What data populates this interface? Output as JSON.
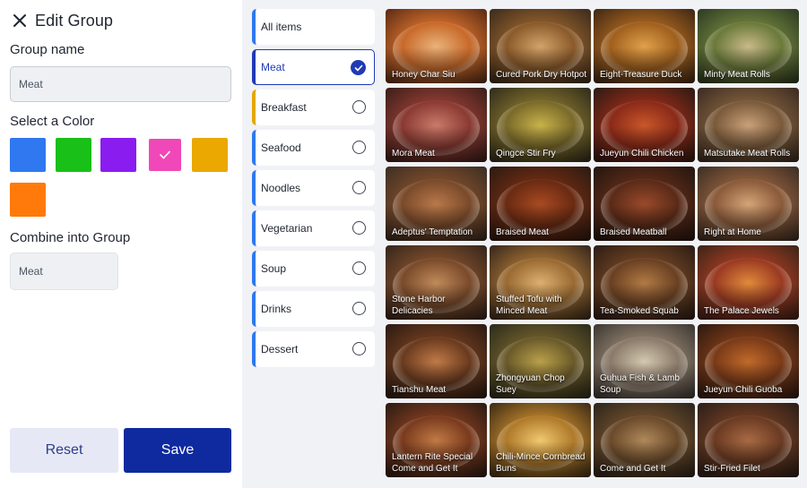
{
  "panel": {
    "title": "Edit Group",
    "group_name_label": "Group name",
    "group_name_value": "Meat",
    "color_label": "Select a Color",
    "colors": [
      "#2f78f0",
      "#18c018",
      "#8a1cf0",
      "#f048b8",
      "#eaa800",
      "#ff7a0a"
    ],
    "selected_color": "#f048b8",
    "combine_label": "Combine into Group",
    "combine_value": "Meat",
    "reset_label": "Reset",
    "save_label": "Save"
  },
  "categories": [
    {
      "label": "All items",
      "state": "none"
    },
    {
      "label": "Meat",
      "state": "checked"
    },
    {
      "label": "Breakfast",
      "state": "radio"
    },
    {
      "label": "Seafood",
      "state": "radio"
    },
    {
      "label": "Noodles",
      "state": "radio"
    },
    {
      "label": "Vegetarian",
      "state": "radio"
    },
    {
      "label": "Soup",
      "state": "radio"
    },
    {
      "label": "Drinks",
      "state": "radio"
    },
    {
      "label": "Dessert",
      "state": "radio"
    }
  ],
  "dishes": [
    "Honey Char Siu",
    "Cured Pork Dry Hotpot",
    "Eight-Treasure Duck",
    "Minty Meat Rolls",
    "Mora Meat",
    "Qingce Stir Fry",
    "Jueyun Chili Chicken",
    "Matsutake Meat Rolls",
    "Adeptus' Temptation",
    "Braised Meat",
    "Braised Meatball",
    "Right at Home",
    "Stone Harbor Delicacies",
    "Stuffed Tofu with Minced Meat",
    "Tea-Smoked Squab",
    "The Palace Jewels",
    "Tianshu Meat",
    "Zhongyuan Chop Suey",
    "Guhua Fish & Lamb Soup",
    "Jueyun Chili Guoba",
    "Lantern Rite Special Come and Get It",
    "Chili-Mince Cornbread Buns",
    "Come and Get It",
    "Stir-Fried Filet"
  ]
}
